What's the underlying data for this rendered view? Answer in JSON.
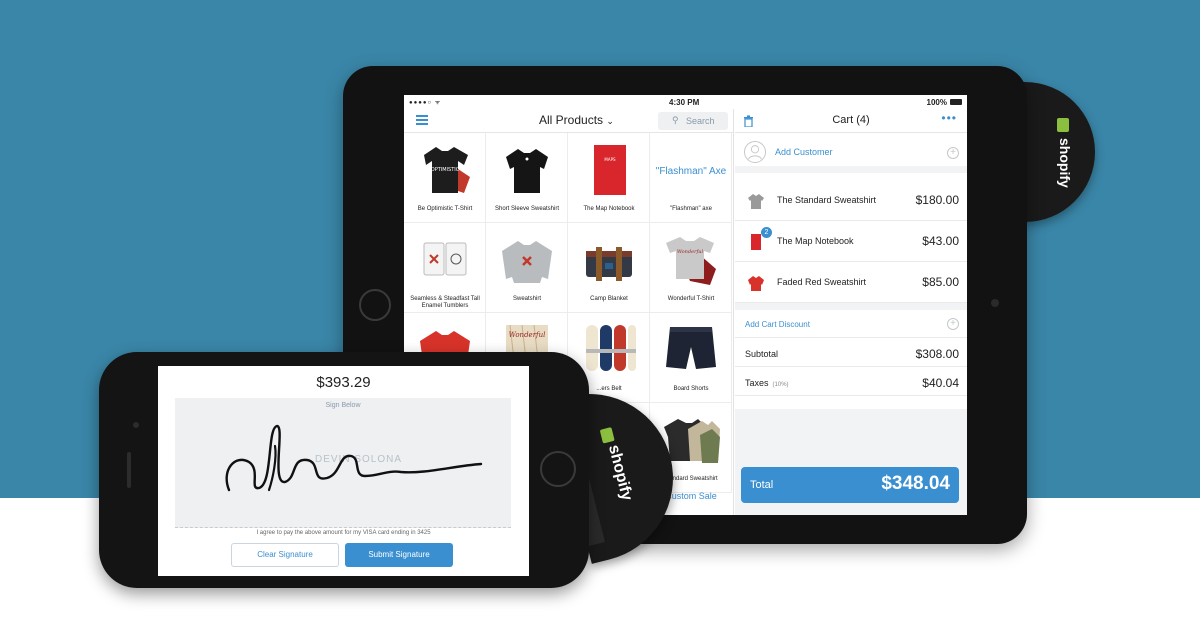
{
  "colors": {
    "background_blue": "#3a86a8",
    "accent": "#3a8fd0",
    "shopify_green": "#8cbf3f"
  },
  "ipad": {
    "status": {
      "time": "4:30 PM",
      "battery": "100%"
    },
    "products": {
      "title": "All Products",
      "search_placeholder": "Search",
      "tiles": [
        {
          "label": "Be Optimistic T-Shirt"
        },
        {
          "label": "Short Sleeve Sweatshirt"
        },
        {
          "label": "The Map Notebook"
        },
        {
          "label": "\"Flashman\" axe",
          "big_text": "\"Flashman\" Axe"
        },
        {
          "label": "Seamless & Steadfast Tall Enamel Tumblers"
        },
        {
          "label": "Sweatshirt"
        },
        {
          "label": "Camp Blanket"
        },
        {
          "label": "Wonderful T-Shirt"
        },
        {
          "label": ""
        },
        {
          "label": ""
        },
        {
          "label": "...ers Belt"
        },
        {
          "label": "Board Shorts"
        },
        {
          "label": ""
        },
        {
          "label": ""
        },
        {
          "label": ""
        },
        {
          "label": "...andard Sweatshirt"
        }
      ],
      "custom_sale": "Custom Sale"
    },
    "cart": {
      "title": "Cart (4)",
      "add_customer": "Add Customer",
      "items": [
        {
          "name": "The Standard Sweatshirt",
          "price": "$180.00",
          "qty": ""
        },
        {
          "name": "The Map Notebook",
          "price": "$43.00",
          "qty": "2"
        },
        {
          "name": "Faded Red Sweatshirt",
          "price": "$85.00",
          "qty": ""
        }
      ],
      "add_discount": "Add Cart Discount",
      "subtotal_label": "Subtotal",
      "subtotal": "$308.00",
      "taxes_label": "Taxes",
      "taxes_rate": "(10%)",
      "taxes": "$40.04",
      "total_label": "Total",
      "total": "$348.04"
    }
  },
  "reader": {
    "brand": "shopify"
  },
  "iphone": {
    "amount": "$393.29",
    "sign_below": "Sign Below",
    "signer_name": "DEVIN SOLONA",
    "agreement": "I agree to pay the above amount for my VISA card ending in 3425",
    "clear_button": "Clear Signature",
    "submit_button": "Submit Signature"
  }
}
